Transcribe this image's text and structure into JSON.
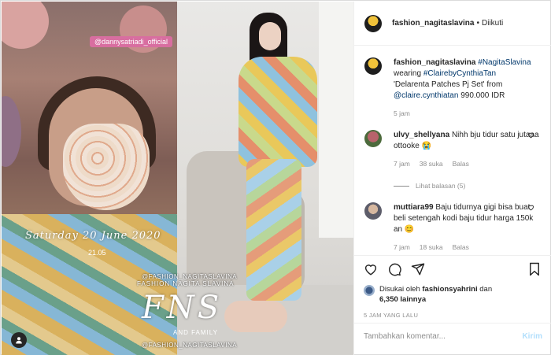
{
  "post": {
    "author": "fashion_nagitaslavina",
    "dot": "•",
    "follow_status": "Diikuti"
  },
  "media": {
    "left_story": {
      "mention_tag": "@dannysatriadi_official",
      "date_text": "Saturday 20 June 2020",
      "time_text": "21.05",
      "watermark_handle": "@FASHION_NAGITASLAVINA",
      "watermark_name": "FASHION NAGITA SLAVINA",
      "logo_text": "FNS",
      "logo_subtext": "AND FAMILY",
      "watermark_handle_bottom": "@FASHION_NAGITASLAVINA"
    }
  },
  "caption": {
    "author": "fashion_nagitaslavina",
    "tag1": "#NagitaSlavina",
    "text1": "wearing",
    "tag2": "#ClairebyCynthiaTan",
    "text2": "'Delarenta Patches Pj Set' from",
    "mention": "@claire.cynthiatan",
    "price": "990.000 IDR",
    "time": "5 jam"
  },
  "comments": [
    {
      "author": "ulvy_shellyana",
      "text": "Nihh bju tidur satu jutaaa ottooke",
      "emoji": "😭",
      "time": "7 jam",
      "likes": "38 suka",
      "reply": "Balas",
      "view_replies": "Lihat balasan (5)"
    },
    {
      "author": "muttiara99",
      "text": "Baju tidurnya gigi bisa buat beli setengah kodi baju tidur harga 150k an",
      "emoji": "😊",
      "time": "7 jam",
      "likes": "18 suka",
      "reply": "Balas"
    }
  ],
  "likes_line": {
    "prefix": "Disukai oleh",
    "user": "fashionsyahrini",
    "and": "dan",
    "count": "6,350 lainnya"
  },
  "time_ago": "5 JAM YANG LALU",
  "comment_box": {
    "placeholder": "Tambahkan komentar...",
    "post_label": "Kirim"
  },
  "colors": {
    "link": "#00376b",
    "post_button": "#b2dffc",
    "mention_tag_bg": "#d86ea0"
  }
}
